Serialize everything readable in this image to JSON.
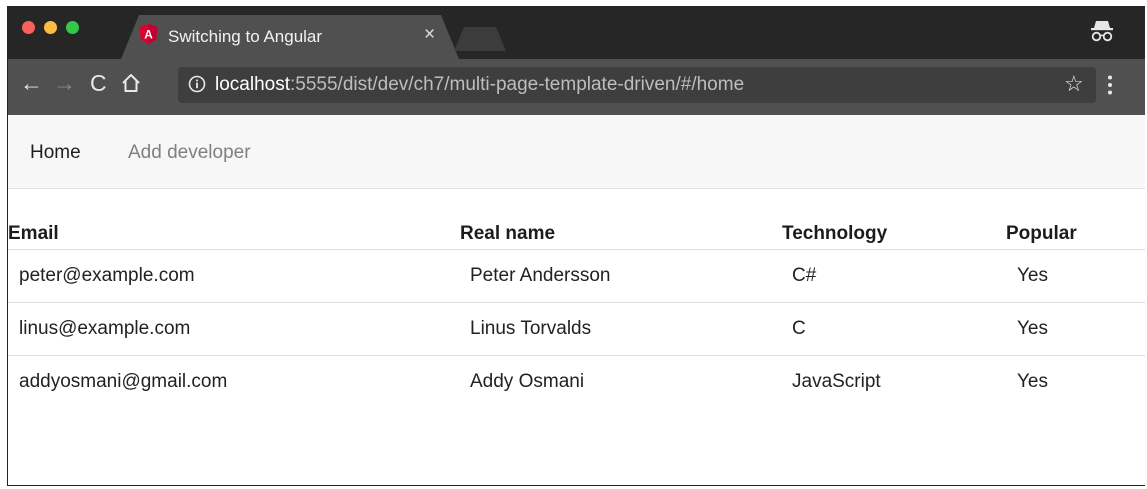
{
  "browser": {
    "tab": {
      "title": "Switching to Angular",
      "close_glyph": "×",
      "icon": "angular-logo-icon",
      "icon_letter": "A",
      "icon_color": "#dd0031"
    },
    "nav": {
      "back_glyph": "←",
      "forward_glyph": "→",
      "reload_glyph": "C",
      "star_glyph": "☆"
    },
    "url": {
      "host": "localhost",
      "path": ":5555/dist/dev/ch7/multi-page-template-driven/#/home"
    }
  },
  "navbar": {
    "home_label": "Home",
    "add_label": "Add developer"
  },
  "table": {
    "headers": {
      "email": "Email",
      "name": "Real name",
      "tech": "Technology",
      "popular": "Popular"
    },
    "rows": [
      {
        "email": "peter@example.com",
        "name": "Peter Andersson",
        "tech": "C#",
        "popular": "Yes"
      },
      {
        "email": "linus@example.com",
        "name": "Linus Torvalds",
        "tech": "C",
        "popular": "Yes"
      },
      {
        "email": "addyosmani@gmail.com",
        "name": "Addy Osmani",
        "tech": "JavaScript",
        "popular": "Yes"
      }
    ]
  },
  "colors": {
    "titlebar": "#262626",
    "toolbar": "#505050",
    "navbar": "#f7f7f7",
    "accent_red": "#dd0031"
  }
}
